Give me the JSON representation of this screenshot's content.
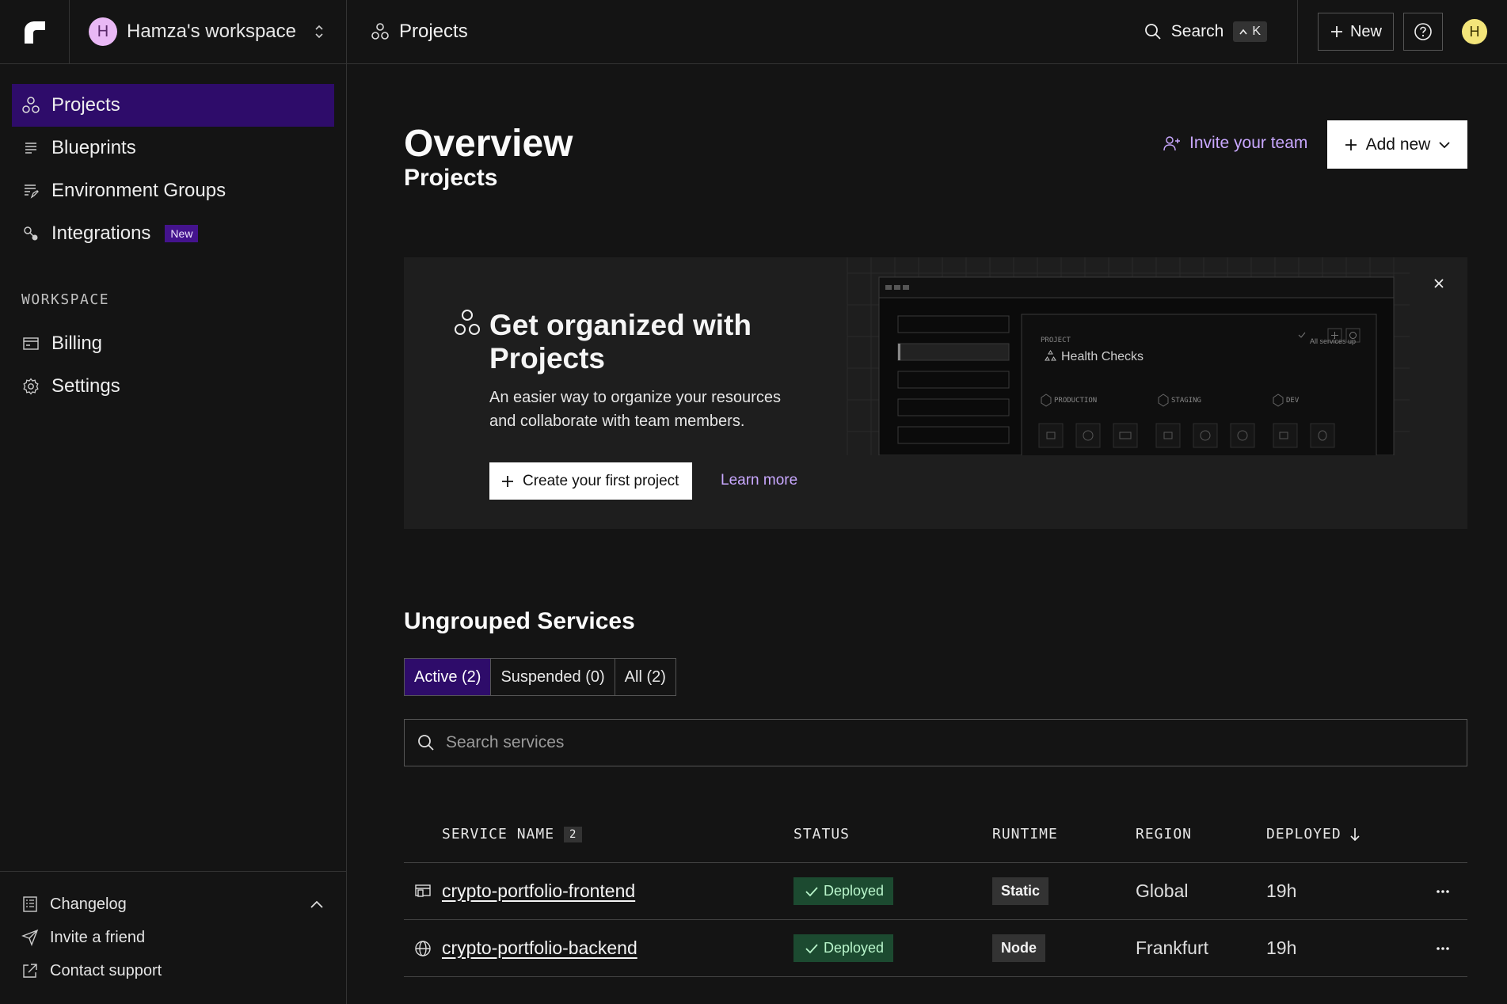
{
  "topbar": {
    "workspace_initial": "H",
    "workspace_name": "Hamza's workspace",
    "breadcrumb": "Projects",
    "search_label": "Search",
    "search_shortcut_key": "K",
    "new_label": "New",
    "user_initial": "H"
  },
  "sidebar": {
    "items": [
      {
        "label": "Projects",
        "icon": "projects-icon",
        "active": true
      },
      {
        "label": "Blueprints",
        "icon": "blueprints-icon"
      },
      {
        "label": "Environment Groups",
        "icon": "env-groups-icon"
      },
      {
        "label": "Integrations",
        "icon": "integrations-icon",
        "badge": "New"
      }
    ],
    "workspace_label": "WORKSPACE",
    "workspace_items": [
      {
        "label": "Billing",
        "icon": "billing-icon"
      },
      {
        "label": "Settings",
        "icon": "settings-icon"
      }
    ],
    "bottom": [
      {
        "label": "Changelog",
        "icon": "changelog-icon"
      },
      {
        "label": "Invite a friend",
        "icon": "send-icon"
      },
      {
        "label": "Contact support",
        "icon": "external-link-icon"
      }
    ]
  },
  "main": {
    "title": "Overview",
    "invite_team": "Invite your team",
    "add_new": "Add new",
    "projects_heading": "Projects",
    "promo": {
      "title": "Get organized with Projects",
      "description": "An easier way to organize your resources and collaborate with team members.",
      "create_button": "Create your first project",
      "learn_more": "Learn more",
      "preview": {
        "project_label": "PROJECT",
        "project_name": "Health Checks",
        "status": "All services up",
        "env_production": "PRODUCTION",
        "env_staging": "STAGING",
        "env_dev": "DEV"
      }
    },
    "ungrouped_heading": "Ungrouped Services",
    "tabs": [
      {
        "label": "Active (2)",
        "active": true
      },
      {
        "label": "Suspended (0)"
      },
      {
        "label": "All (2)"
      }
    ],
    "search_placeholder": "Search services",
    "table": {
      "headers": {
        "name": "SERVICE NAME",
        "name_count": "2",
        "status": "STATUS",
        "runtime": "RUNTIME",
        "region": "REGION",
        "deployed": "DEPLOYED"
      },
      "rows": [
        {
          "name": "crypto-portfolio-frontend",
          "icon": "static-site-icon",
          "status": "Deployed",
          "runtime": "Static",
          "region": "Global",
          "deployed": "19h"
        },
        {
          "name": "crypto-portfolio-backend",
          "icon": "globe-icon",
          "status": "Deployed",
          "runtime": "Node",
          "region": "Frankfurt",
          "deployed": "19h"
        }
      ]
    }
  },
  "colors": {
    "background": "#141414",
    "accent_purple": "#2e0c6a",
    "link_purple": "#c9a8ff",
    "deployed_green": "#1c4a30"
  }
}
